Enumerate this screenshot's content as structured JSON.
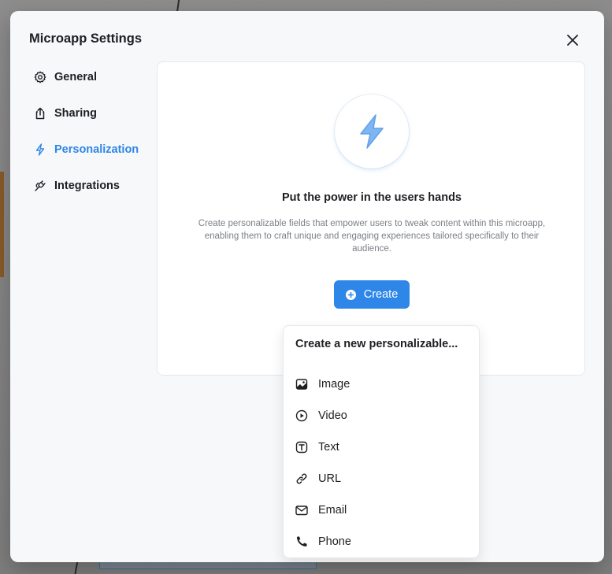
{
  "modal": {
    "title": "Microapp Settings",
    "close_icon": "close-icon"
  },
  "sidebar": {
    "items": [
      {
        "label": "General",
        "icon": "gear-icon",
        "active": false
      },
      {
        "label": "Sharing",
        "icon": "share-icon",
        "active": false
      },
      {
        "label": "Personalization",
        "icon": "bolt-icon",
        "active": true
      },
      {
        "label": "Integrations",
        "icon": "plug-icon",
        "active": false
      }
    ]
  },
  "panel": {
    "hero_icon": "bolt-icon",
    "heading": "Put the power in the users hands",
    "description": "Create personalizable fields that empower users to tweak content within this microapp, enabling them to craft unique and engaging experiences tailored specifically to their audience.",
    "create_label": "Create"
  },
  "dropdown": {
    "title": "Create a new personalizable...",
    "items": [
      {
        "label": "Image",
        "icon": "image-icon"
      },
      {
        "label": "Video",
        "icon": "play-icon"
      },
      {
        "label": "Text",
        "icon": "text-icon"
      },
      {
        "label": "URL",
        "icon": "link-icon"
      },
      {
        "label": "Email",
        "icon": "mail-icon"
      },
      {
        "label": "Phone",
        "icon": "phone-icon"
      }
    ]
  },
  "colors": {
    "accent": "#2e86e8",
    "text": "#1d1f23",
    "muted": "#7b7f86"
  }
}
